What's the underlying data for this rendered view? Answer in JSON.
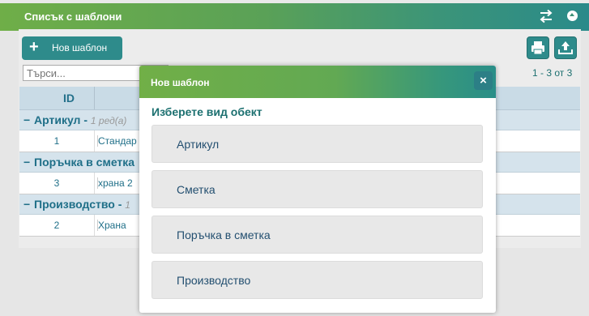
{
  "panel": {
    "title": "Списък с шаблони",
    "new_button_label": "Нов шаблон",
    "search_placeholder": "Търси...",
    "pager_text": "1 - 3 от 3"
  },
  "table": {
    "columns": [
      "ID",
      ""
    ],
    "groups": [
      {
        "name": "Артикул",
        "count": "1 ред(а)",
        "rows": [
          {
            "id": "1",
            "name": "Стандар"
          }
        ]
      },
      {
        "name": "Поръчка в сметка",
        "count": "",
        "rows": [
          {
            "id": "3",
            "name": "храна 2"
          }
        ]
      },
      {
        "name": "Производство",
        "count": "1",
        "rows": [
          {
            "id": "2",
            "name": "Храна"
          }
        ]
      }
    ]
  },
  "modal": {
    "title": "Нов шаблон",
    "close_label": "×",
    "subtitle": "Изберете вид обект",
    "options": [
      "Артикул",
      "Сметка",
      "Поръчка в сметка",
      "Производство"
    ]
  },
  "colors": {
    "header_start": "#6fae48",
    "header_end": "#2a8a8a",
    "button": "#2e8b8b",
    "accent_text": "#1c7070"
  },
  "icons": [
    "plus-icon",
    "swap-icon",
    "collapse-icon",
    "print-icon",
    "export-icon",
    "close-icon",
    "minus-icon"
  ]
}
